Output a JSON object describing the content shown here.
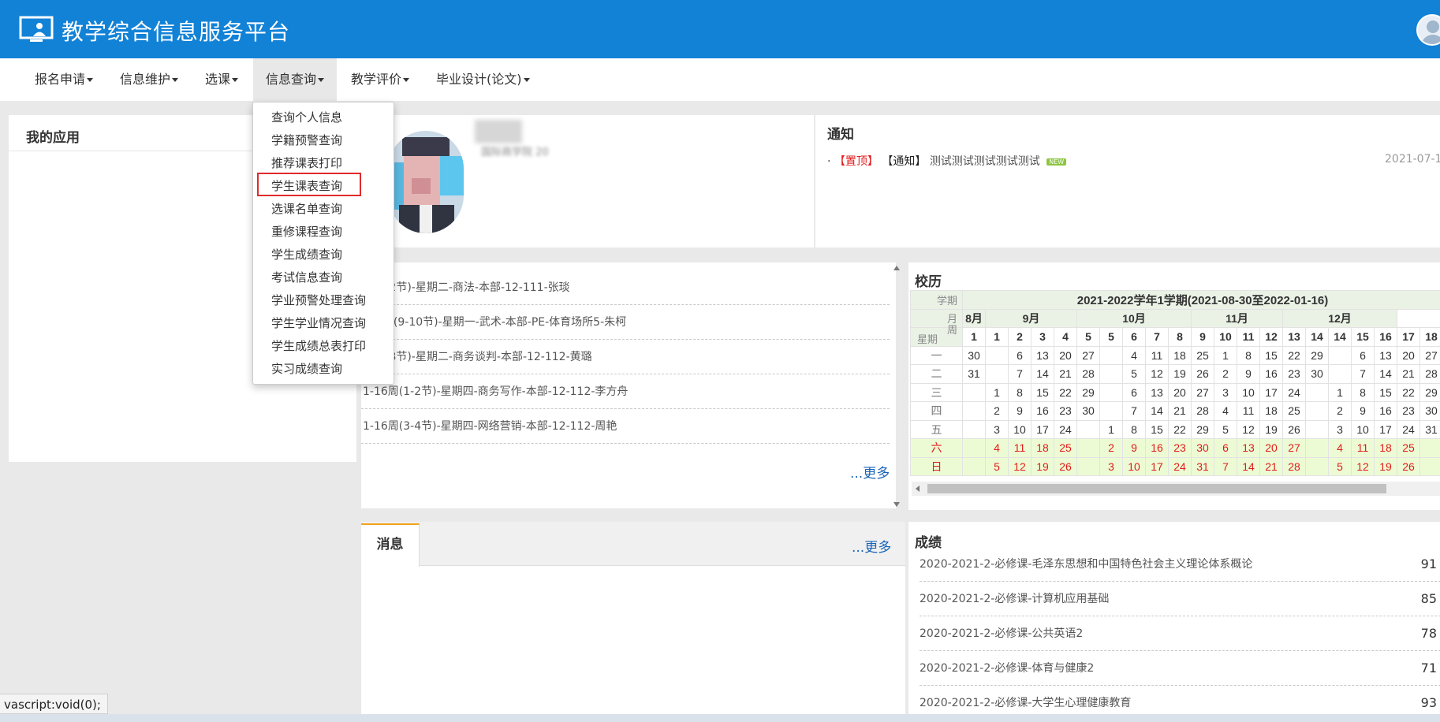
{
  "header": {
    "title": "教学综合信息服务平台"
  },
  "nav": [
    {
      "label": "报名申请"
    },
    {
      "label": "信息维护"
    },
    {
      "label": "选课"
    },
    {
      "label": "信息查询"
    },
    {
      "label": "教学评价"
    },
    {
      "label": "毕业设计(论文)"
    }
  ],
  "dropdown": {
    "items": [
      "查询个人信息",
      "学籍预警查询",
      "推荐课表打印",
      "学生课表查询",
      "选课名单查询",
      "重修课程查询",
      "学生成绩查询",
      "考试信息查询",
      "学业预警处理查询",
      "学生学业情况查询",
      "学生成绩总表打印",
      "实习成绩查询"
    ],
    "highlighted": "学生课表查询"
  },
  "apps": {
    "title": "我的应用"
  },
  "profile": {
    "subtext": "国际商学院 20"
  },
  "notice": {
    "title": "通知",
    "bullet": "·",
    "top_tag": "【置顶】",
    "type_tag": "【通知】",
    "text": "测试测试测试测试测试",
    "badge": "NEW",
    "date": "2021-07-1"
  },
  "schedule": {
    "items": [
      "周(1-2节)-星期二-商法-本部-12-111-张琰",
      "周(双)(9-10节)-星期一-武术-本部-PE-体育场所5-朱柯",
      "周(7-8节)-星期二-商务谈判-本部-12-112-黄璐",
      "1-16周(1-2节)-星期四-商务写作-本部-12-112-李方舟",
      "1-16周(3-4节)-星期四-网络营销-本部-12-112-周艳"
    ],
    "more": "...更多"
  },
  "calendar": {
    "title": "校历",
    "semester": "2021-2022学年1学期(2021-08-30至2022-01-16)",
    "corner": {
      "term": "学期",
      "month": "月",
      "week": "周",
      "weekday": "星期"
    },
    "months": [
      {
        "name": "8月",
        "span": 1
      },
      {
        "name": "9月",
        "span": 4
      },
      {
        "name": "10月",
        "span": 5
      },
      {
        "name": "11月",
        "span": 4
      },
      {
        "name": "12月",
        "span": 5
      }
    ],
    "weeks": [
      "1",
      "1",
      "2",
      "3",
      "4",
      "5",
      "5",
      "6",
      "7",
      "8",
      "9",
      "10",
      "11",
      "12",
      "13",
      "14",
      "14",
      "15",
      "16",
      "17",
      "18"
    ],
    "rows": [
      {
        "day": "一",
        "weekend": false,
        "cells": [
          "30",
          "",
          "6",
          "13",
          "20",
          "27",
          "",
          "4",
          "11",
          "18",
          "25",
          "1",
          "8",
          "15",
          "22",
          "29",
          "",
          "6",
          "13",
          "20",
          "27"
        ]
      },
      {
        "day": "二",
        "weekend": false,
        "cells": [
          "31",
          "",
          "7",
          "14",
          "21",
          "28",
          "",
          "5",
          "12",
          "19",
          "26",
          "2",
          "9",
          "16",
          "23",
          "30",
          "",
          "7",
          "14",
          "21",
          "28"
        ]
      },
      {
        "day": "三",
        "weekend": false,
        "cells": [
          "",
          "1",
          "8",
          "15",
          "22",
          "29",
          "",
          "6",
          "13",
          "20",
          "27",
          "3",
          "10",
          "17",
          "24",
          "",
          "1",
          "8",
          "15",
          "22",
          "29"
        ]
      },
      {
        "day": "四",
        "weekend": false,
        "cells": [
          "",
          "2",
          "9",
          "16",
          "23",
          "30",
          "",
          "7",
          "14",
          "21",
          "28",
          "4",
          "11",
          "18",
          "25",
          "",
          "2",
          "9",
          "16",
          "23",
          "30"
        ]
      },
      {
        "day": "五",
        "weekend": false,
        "cells": [
          "",
          "3",
          "10",
          "17",
          "24",
          "",
          "1",
          "8",
          "15",
          "22",
          "29",
          "5",
          "12",
          "19",
          "26",
          "",
          "3",
          "10",
          "17",
          "24",
          "31"
        ]
      },
      {
        "day": "六",
        "weekend": true,
        "cells": [
          "",
          "4",
          "11",
          "18",
          "25",
          "",
          "2",
          "9",
          "16",
          "23",
          "30",
          "6",
          "13",
          "20",
          "27",
          "",
          "4",
          "11",
          "18",
          "25",
          ""
        ]
      },
      {
        "day": "日",
        "weekend": true,
        "cells": [
          "",
          "5",
          "12",
          "19",
          "26",
          "",
          "3",
          "10",
          "17",
          "24",
          "31",
          "7",
          "14",
          "21",
          "28",
          "",
          "5",
          "12",
          "19",
          "26",
          ""
        ]
      }
    ]
  },
  "messages": {
    "tab": "消息",
    "more": "...更多"
  },
  "grades": {
    "title": "成绩",
    "items": [
      {
        "course": "2020-2021-2-必修课-毛泽东思想和中国特色社会主义理论体系概论",
        "score": "91"
      },
      {
        "course": "2020-2021-2-必修课-计算机应用基础",
        "score": "85"
      },
      {
        "course": "2020-2021-2-必修课-公共英语2",
        "score": "78"
      },
      {
        "course": "2020-2021-2-必修课-体育与健康2",
        "score": "71"
      },
      {
        "course": "2020-2021-2-必修课-大学生心理健康教育",
        "score": "93"
      }
    ]
  },
  "status": {
    "tip": "vascript:void(0);"
  },
  "colors": {
    "header": "#1282d7",
    "accent_red": "#e21b1b",
    "link": "#1a63b6",
    "tab_accent": "#f0a31a"
  }
}
